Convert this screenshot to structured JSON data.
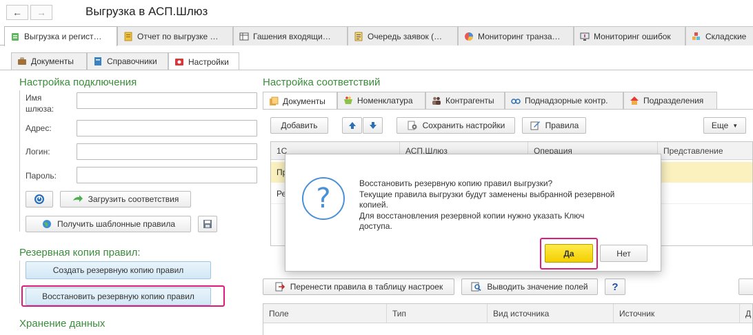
{
  "window": {
    "title": "Выгрузка в АСП.Шлюз"
  },
  "nav": {
    "back": "←",
    "forward": "→"
  },
  "main_tabs": [
    {
      "label": "Выгрузка и регист…"
    },
    {
      "label": "Отчет по выгрузке …"
    },
    {
      "label": "Гашения входящи…"
    },
    {
      "label": "Очередь заявок (…"
    },
    {
      "label": "Мониторинг транза…"
    },
    {
      "label": "Мониторинг ошибок"
    },
    {
      "label": "Складские"
    }
  ],
  "sub_tabs": [
    {
      "label": "Документы"
    },
    {
      "label": "Справочники"
    },
    {
      "label": "Настройки"
    }
  ],
  "connection": {
    "heading": "Настройка подключения",
    "gateway_label": "Имя\nшлюза:",
    "address_label": "Адрес:",
    "login_label": "Логин:",
    "password_label": "Пароль:",
    "load_button": "Загрузить соответствия",
    "templates_button": "Получить шаблонные правила"
  },
  "backup": {
    "heading": "Резервная копия правил:",
    "create_button": "Создать резервную копию правил",
    "restore_button": "Восстановить резервную копию правил"
  },
  "storage": {
    "heading": "Хранение данных"
  },
  "mapping": {
    "heading": "Настройка соответствий",
    "tabs": [
      {
        "label": "Документы"
      },
      {
        "label": "Номенклатура"
      },
      {
        "label": "Контрагенты"
      },
      {
        "label": "Поднадзорные контр."
      },
      {
        "label": "Подразделения"
      }
    ],
    "toolbar": {
      "add": "Добавить",
      "save_settings": "Сохранить настройки",
      "rules": "Правила",
      "more": "Еще"
    },
    "columns": [
      "1С",
      "АСП.Шлюз",
      "Операция",
      "Представление"
    ],
    "rows": [
      {
        "c1": "Пр"
      },
      {
        "c1": "Ре"
      }
    ]
  },
  "lower": {
    "transfer_button": "Перенести правила в таблицу настроек",
    "show_values_button": "Выводить значение полей",
    "help_button": "?",
    "columns": [
      "Поле",
      "Тип",
      "Вид источника",
      "Источник",
      "Д"
    ]
  },
  "dialog": {
    "icon": "?",
    "lines": [
      "Восстановить резервную копию правил выгрузки?",
      "Текущие правила выгрузки будут заменены выбранной резервной",
      "копией.",
      "Для восстановления резервной копии нужно указать Ключ",
      "доступа."
    ],
    "yes": "Да",
    "no": "Нет"
  }
}
